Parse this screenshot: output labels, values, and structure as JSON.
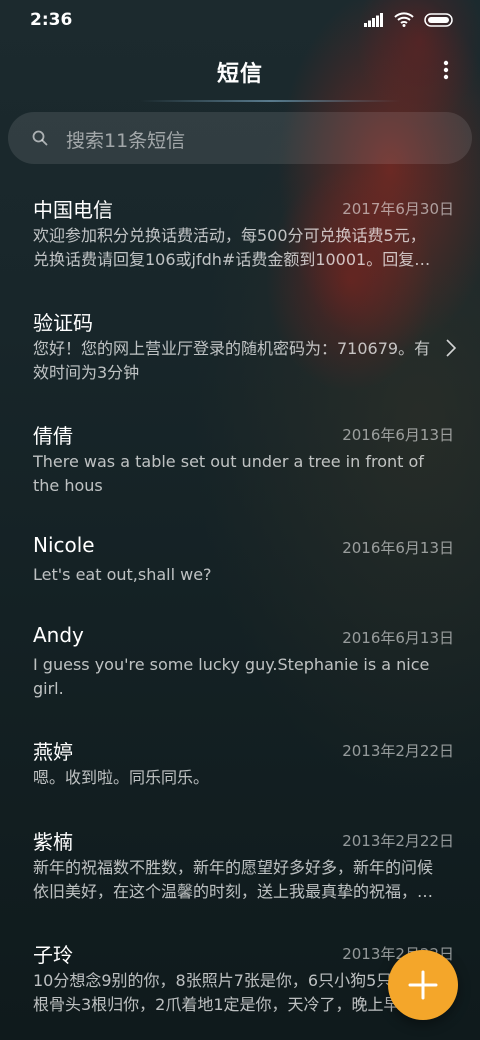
{
  "status_bar": {
    "time": "2:36"
  },
  "header": {
    "title": "短信"
  },
  "search": {
    "placeholder": "搜索11条短信"
  },
  "messages": [
    {
      "sender": "中国电信",
      "date": "2017年6月30日",
      "preview": "欢迎参加积分兑换话费活动，每500分可兑换话费5元，兑换话费请回复106或jfdh#话费金额到10001。回复办理宽带提速"
    },
    {
      "sender": "验证码",
      "date": "",
      "preview": "您好！您的网上营业厅登录的随机密码为：710679。有效时间为3分钟"
    },
    {
      "sender": "倩倩",
      "date": "2016年6月13日",
      "preview": "There was a table set out under a tree in front of the hous"
    },
    {
      "sender": "Nicole",
      "date": "2016年6月13日",
      "preview": "Let's eat out,shall we?"
    },
    {
      "sender": "Andy",
      "date": "2016年6月13日",
      "preview": "I guess you're some lucky guy.Stephanie is a nice girl."
    },
    {
      "sender": "燕婷",
      "date": "2013年2月22日",
      "preview": "嗯。收到啦。同乐同乐。"
    },
    {
      "sender": "紫楠",
      "date": "2013年2月22日",
      "preview": "新年的祝福数不胜数，新年的愿望好多好多，新年的问候依旧美好，在这个温馨的时刻，送上我最真挚的祝福，愿你新年快乐"
    },
    {
      "sender": "子玲",
      "date": "2013年2月22日",
      "preview": "10分想念9别的你，8张照片7张是你，6只小狗5只狗，4根骨头3根归你，2爪着地1定是你，天冷了，晚上早点睡"
    }
  ],
  "colors": {
    "fab": "#f4a62a",
    "accent_line": "#8cbedc"
  },
  "icons": {
    "search": "search-icon",
    "more": "more-vertical-icon",
    "compose": "plus-icon",
    "chevron": "chevron-right-icon"
  }
}
